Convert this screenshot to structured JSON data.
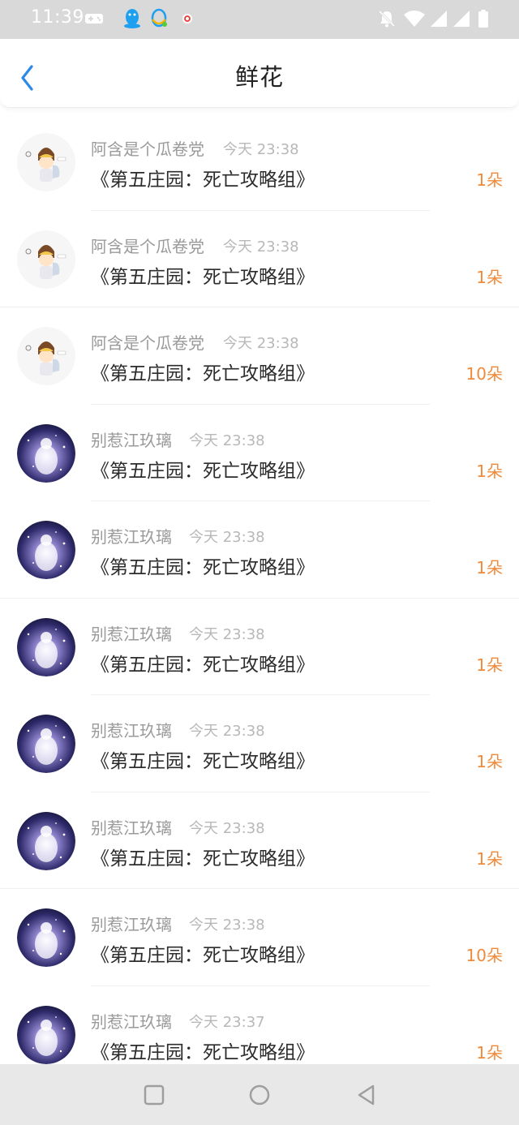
{
  "status_bar": {
    "time": "11:39",
    "left_icons": [
      "gamepad-icon",
      "qq-penguin-icon",
      "qq-support-icon",
      "notification-dot-icon"
    ],
    "right_icons": [
      "mute-bell-icon",
      "wifi-icon",
      "signal-icon",
      "signal-icon",
      "battery-icon"
    ]
  },
  "header": {
    "title": "鲜花",
    "back_icon": "chevron-left-icon"
  },
  "colors": {
    "accent_blue": "#2b8ae8",
    "count_orange": "#f08a3a",
    "secondary_text": "#9a9a9a"
  },
  "list": {
    "items": [
      {
        "user": "阿含是个瓜卷党",
        "time": "今天 23:38",
        "work": "《第五庄园：死亡攻略组》",
        "count": "1朵",
        "avatar": "chibi-avatar"
      },
      {
        "user": "阿含是个瓜卷党",
        "time": "今天 23:38",
        "work": "《第五庄园：死亡攻略组》",
        "count": "1朵",
        "avatar": "chibi-avatar"
      },
      {
        "user": "阿含是个瓜卷党",
        "time": "今天 23:38",
        "work": "《第五庄园：死亡攻略组》",
        "count": "10朵",
        "avatar": "chibi-avatar"
      },
      {
        "user": "别惹江玖璃",
        "time": "今天 23:38",
        "work": "《第五庄园：死亡攻略组》",
        "count": "1朵",
        "avatar": "galaxy-avatar"
      },
      {
        "user": "别惹江玖璃",
        "time": "今天 23:38",
        "work": "《第五庄园：死亡攻略组》",
        "count": "1朵",
        "avatar": "galaxy-avatar"
      },
      {
        "user": "别惹江玖璃",
        "time": "今天 23:38",
        "work": "《第五庄园：死亡攻略组》",
        "count": "1朵",
        "avatar": "galaxy-avatar"
      },
      {
        "user": "别惹江玖璃",
        "time": "今天 23:38",
        "work": "《第五庄园：死亡攻略组》",
        "count": "1朵",
        "avatar": "galaxy-avatar"
      },
      {
        "user": "别惹江玖璃",
        "time": "今天 23:38",
        "work": "《第五庄园：死亡攻略组》",
        "count": "1朵",
        "avatar": "galaxy-avatar"
      },
      {
        "user": "别惹江玖璃",
        "time": "今天 23:38",
        "work": "《第五庄园：死亡攻略组》",
        "count": "10朵",
        "avatar": "galaxy-avatar"
      },
      {
        "user": "别惹江玖璃",
        "time": "今天 23:37",
        "work": "《第五庄园：死亡攻略组》",
        "count": "1朵",
        "avatar": "galaxy-avatar"
      }
    ]
  },
  "nav_bar": {
    "buttons": [
      "recents-square-icon",
      "home-circle-icon",
      "back-triangle-icon"
    ]
  }
}
